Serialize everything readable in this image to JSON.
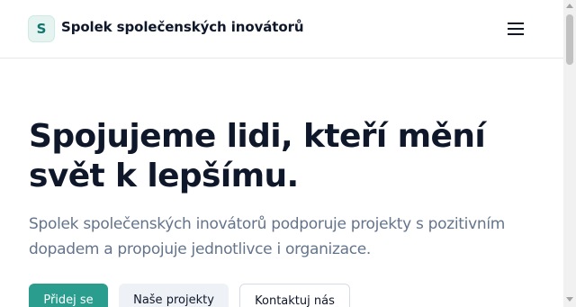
{
  "header": {
    "logo_letter": "S",
    "brand_name": "Spolek společenských inovátorů",
    "menu_icon": "hamburger-menu-icon"
  },
  "hero": {
    "title": "Spojujeme lidi, kteří mění svět k lepšímu.",
    "subtitle": "Spolek společenských inovátorů podporuje projekty s pozitivním dopadem a propojuje jednotlivce i organizace."
  },
  "actions": {
    "primary_label": "Přidej se",
    "secondary_label": "Naše projekty",
    "outline_label": "Kontaktuj nás"
  },
  "colors": {
    "accent": "#2a9d8f",
    "text": "#0f172a",
    "muted": "#64748b"
  }
}
